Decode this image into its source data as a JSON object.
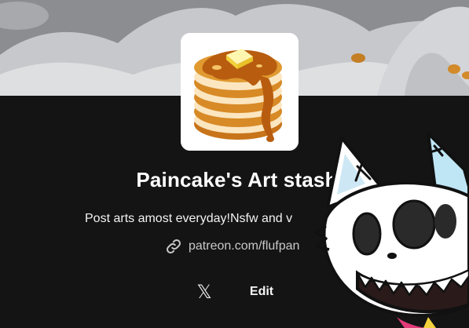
{
  "profile": {
    "name": "Paincake's Art stash",
    "tagline": "Post arts amost everyday!Nsfw and v",
    "link_text": "patreon.com/flufpan"
  },
  "actions": {
    "social_icon": "x-logo-icon",
    "social_glyph": "𝕏",
    "edit_label": "Edit"
  },
  "icons": {
    "link": "link-icon",
    "avatar": "pancake-stack-illustration",
    "mascot": "cartoon-cat-character"
  },
  "colors": {
    "background": "#141414",
    "banner": "#8a8c90",
    "accent_syrup": "#c8741a",
    "text_primary": "#ffffff",
    "text_secondary": "#c9c9c9"
  }
}
